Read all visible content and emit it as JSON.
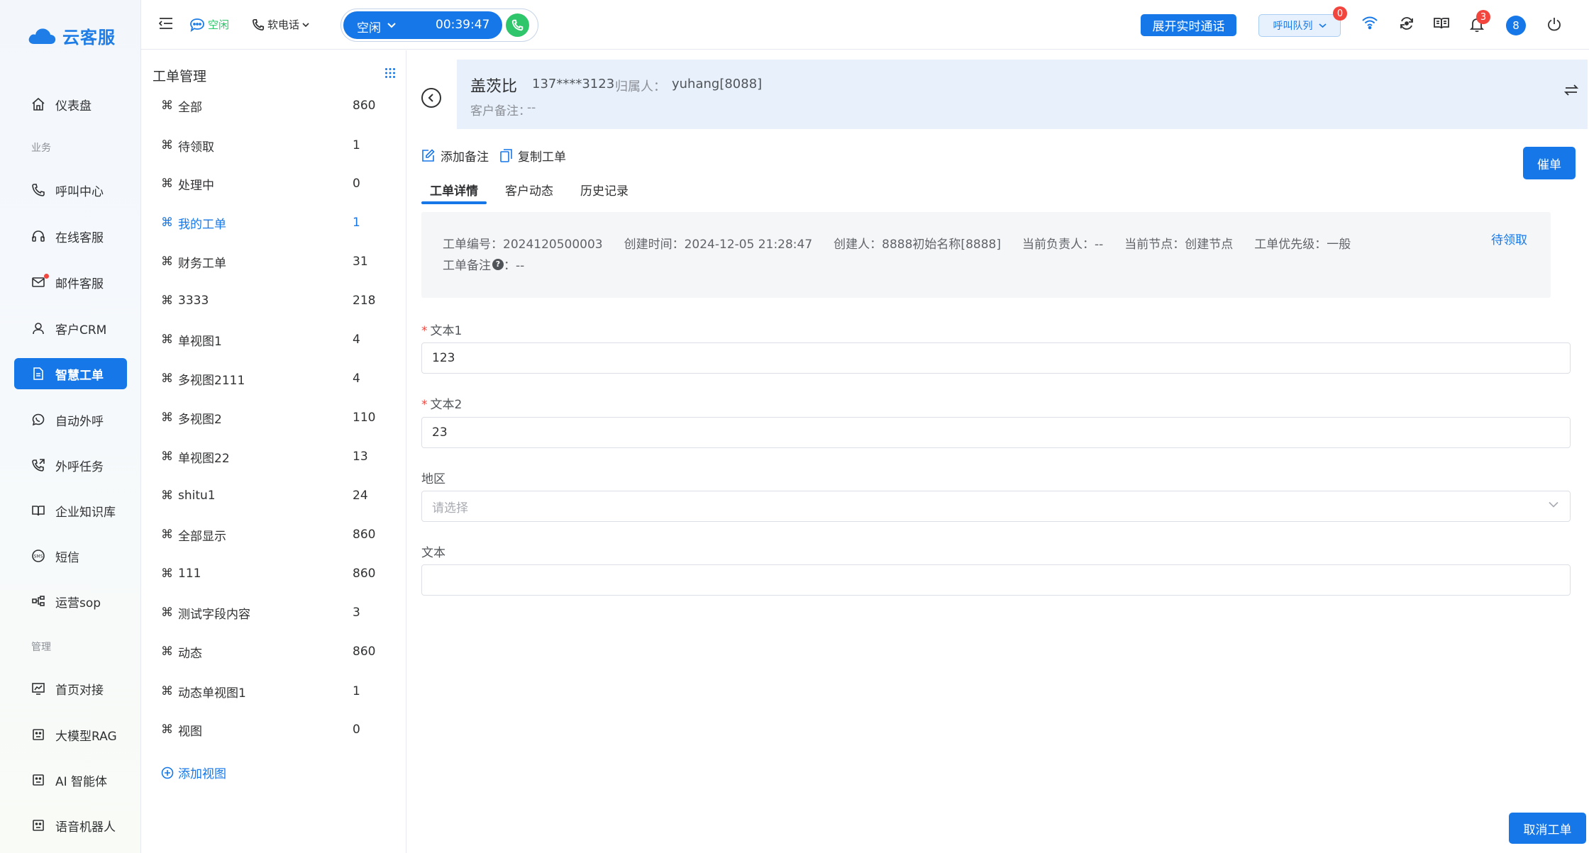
{
  "app": {
    "name": "云客服"
  },
  "sidebar": {
    "items": [
      {
        "label": "仪表盘",
        "icon": "home-icon"
      },
      {
        "label": "呼叫中心",
        "icon": "phone-icon"
      },
      {
        "label": "在线客服",
        "icon": "headset-icon"
      },
      {
        "label": "邮件客服",
        "icon": "mail-icon"
      },
      {
        "label": "客户CRM",
        "icon": "user-icon"
      },
      {
        "label": "智慧工单",
        "icon": "document-icon"
      },
      {
        "label": "自动外呼",
        "icon": "whatsapp-phone-icon"
      },
      {
        "label": "外呼任务",
        "icon": "phone-outgoing-icon"
      },
      {
        "label": "企业知识库",
        "icon": "book-icon"
      },
      {
        "label": "短信",
        "icon": "sms-icon"
      },
      {
        "label": "运营sop",
        "icon": "flow-icon"
      },
      {
        "label": "首页对接",
        "icon": "chart-icon"
      },
      {
        "label": "大模型RAG",
        "icon": "robot-icon"
      },
      {
        "label": "AI 智能体",
        "icon": "robot-icon"
      },
      {
        "label": "语音机器人",
        "icon": "robot-icon"
      }
    ],
    "sections": {
      "business": "业务",
      "management": "管理"
    }
  },
  "topbar": {
    "presence_status": "空闲",
    "softphone_label": "软电话",
    "call_status": "空闲",
    "call_timer": "00:39:47",
    "expand_call_label": "展开实时通话",
    "queue_label": "呼叫队列",
    "queue_badge": "0",
    "notification_badge": "3",
    "avatar_text": "8"
  },
  "workorder_panel": {
    "title": "工单管理",
    "views": [
      {
        "label": "全部",
        "count": "860"
      },
      {
        "label": "待领取",
        "count": "1"
      },
      {
        "label": "处理中",
        "count": "0"
      },
      {
        "label": "我的工单",
        "count": "1",
        "active": true
      },
      {
        "label": "财务工单",
        "count": "31"
      },
      {
        "label": "3333",
        "count": "218"
      },
      {
        "label": "单视图1",
        "count": "4"
      },
      {
        "label": "多视图2111",
        "count": "4"
      },
      {
        "label": "多视图2",
        "count": "110"
      },
      {
        "label": "单视图22",
        "count": "13"
      },
      {
        "label": "shitu1",
        "count": "24"
      },
      {
        "label": "全部显示",
        "count": "860"
      },
      {
        "label": "111",
        "count": "860"
      },
      {
        "label": "测试字段内容",
        "count": "3"
      },
      {
        "label": "动态",
        "count": "860"
      },
      {
        "label": "动态单视图1",
        "count": "1"
      },
      {
        "label": "视图",
        "count": "0"
      }
    ],
    "add_view_label": "添加视图"
  },
  "customer": {
    "name": "盖茨比",
    "phone": "137****3123",
    "owner_label": "归属人：",
    "owner_value": "yuhang[8088]",
    "note_label": "客户备注：",
    "note_value": "--"
  },
  "actions": {
    "add_note": "添加备注",
    "copy_ticket": "复制工单",
    "urge": "催单",
    "cancel": "取消工单"
  },
  "tabs": [
    {
      "label": "工单详情",
      "active": true
    },
    {
      "label": "客户动态"
    },
    {
      "label": "历史记录"
    }
  ],
  "ticket_info": {
    "fields": [
      {
        "label": "工单编号：",
        "value": "2024120500003"
      },
      {
        "label": "创建时间：",
        "value": "2024-12-05 21:28:47"
      },
      {
        "label": "创建人：",
        "value": "8888初始名称[8888]"
      },
      {
        "label": "当前负责人：",
        "value": "--"
      },
      {
        "label": "当前节点：",
        "value": "创建节点"
      },
      {
        "label": "工单优先级：",
        "value": "一般"
      }
    ],
    "remark_label": "工单备注",
    "remark_value": "：--",
    "claim_label": "待领取"
  },
  "form": {
    "text1": {
      "label": "文本1",
      "value": "123"
    },
    "text2": {
      "label": "文本2",
      "value": "23"
    },
    "region": {
      "label": "地区",
      "placeholder": "请选择"
    },
    "text": {
      "label": "文本",
      "value": ""
    }
  },
  "colors": {
    "accent": "#1677e8",
    "call_green": "#2fc56b",
    "badge_red": "#f2453d",
    "card_bg": "#e8f1fb"
  }
}
